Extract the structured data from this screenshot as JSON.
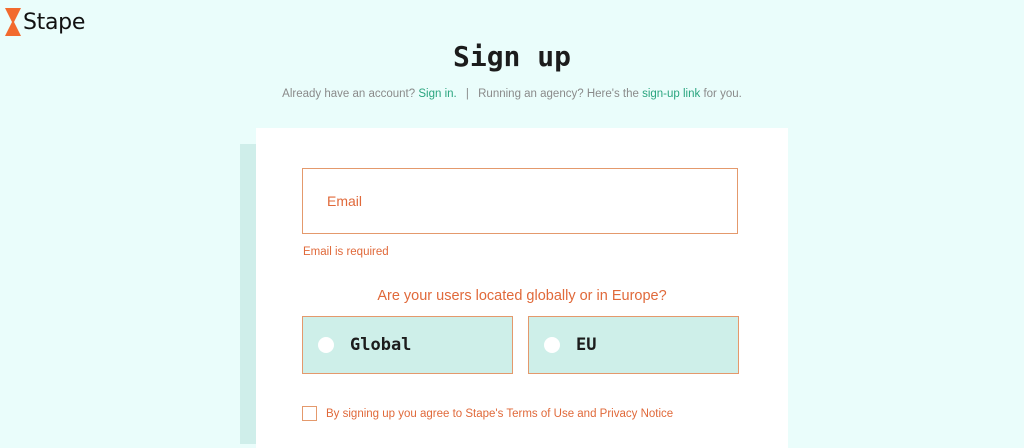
{
  "brand": {
    "name": "Stape",
    "accent_color": "#f26a2e"
  },
  "page": {
    "title": "Sign up"
  },
  "subtitle": {
    "account_prefix": "Already have an account?",
    "sign_in_link": "Sign in.",
    "separator": "|",
    "agency_prefix": "Running an agency? Here's the",
    "agency_link": "sign-up link",
    "agency_suffix": "for you."
  },
  "form": {
    "email": {
      "placeholder": "Email",
      "value": "",
      "error": "Email is required"
    },
    "location_question": "Are your users located globally or in Europe?",
    "location_options": [
      {
        "label": "Global",
        "selected": false
      },
      {
        "label": "EU",
        "selected": false
      }
    ],
    "terms": {
      "label": "By signing up you agree to Stape's Terms of Use and Privacy Notice",
      "checked": false
    }
  },
  "colors": {
    "background": "#eafdfb",
    "link": "#2aa57f",
    "error": "#e0693a",
    "option_fill": "#ceefe9"
  }
}
